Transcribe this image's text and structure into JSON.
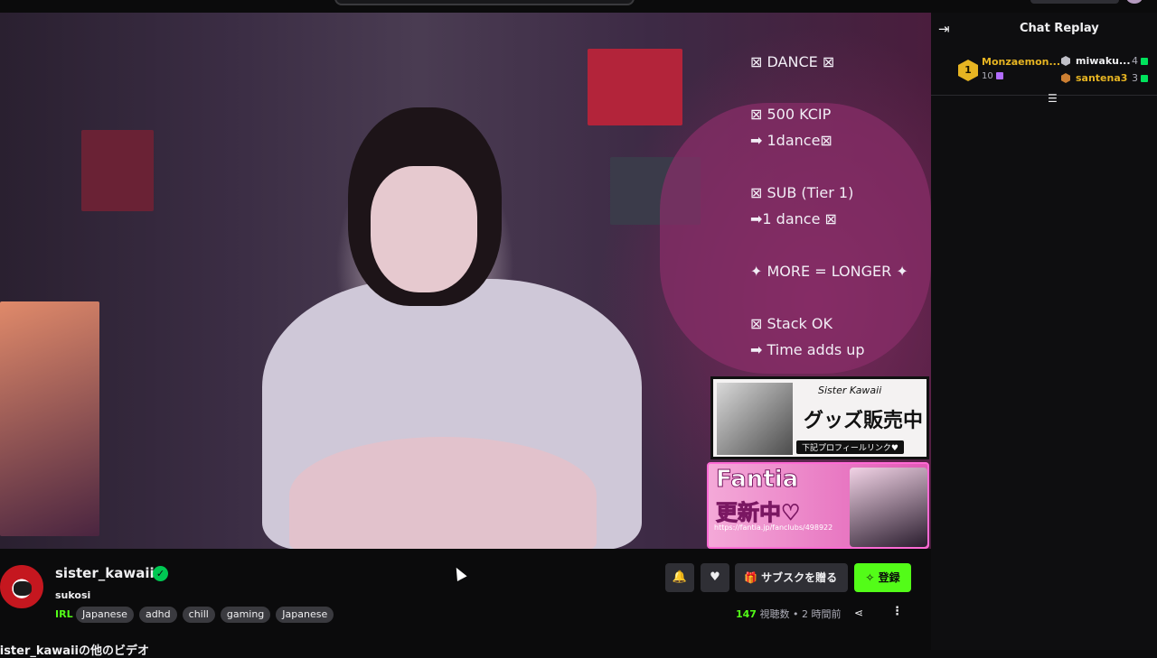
{
  "overlay": {
    "lines": [
      "⊠ DANCE ⊠",
      "⊠ 500 KCIP",
      "➡ 1dance⊠",
      "⊠ SUB (Tier 1)",
      "➡1 dance ⊠",
      "✦ MORE = LONGER ✦",
      "⊠ Stack OK",
      "➡ Time adds up"
    ]
  },
  "promo": {
    "goods_brand": "Sister Kawaii",
    "goods_title": "グッズ販売中",
    "goods_sub": "下記プロフィールリンク♥",
    "fantia_title": "Fantia",
    "fantia_sub": "更新中♡",
    "fantia_url": "https://fantia.jp/fanclubs/498922"
  },
  "chat": {
    "title": "Chat Replay",
    "leaderboard": [
      {
        "rank": "1",
        "name": "Monzaemon...",
        "count": "10",
        "color": "#e6b422"
      },
      {
        "rank": "2",
        "name": "miwaku...",
        "count": "4",
        "color": "#c0c0c8"
      },
      {
        "rank": "3",
        "name": "santena3",
        "count": "3",
        "color": "#cd7f32"
      }
    ]
  },
  "channel": {
    "name": "sister_kawaii",
    "stream_title": "sukosi",
    "category": "IRL",
    "tags": [
      "Japanese",
      "adhd",
      "chill",
      "gaming",
      "Japanese"
    ],
    "viewers": "147",
    "viewers_label": "視聴数",
    "time_ago": "2 時間前",
    "gift_label": "サブスクを贈る",
    "follow_label": "登録",
    "other_videos": "sister_kawaiiの他のビデオ"
  },
  "colors": {
    "brand_green": "#53fc18",
    "gold": "#e6b422"
  }
}
